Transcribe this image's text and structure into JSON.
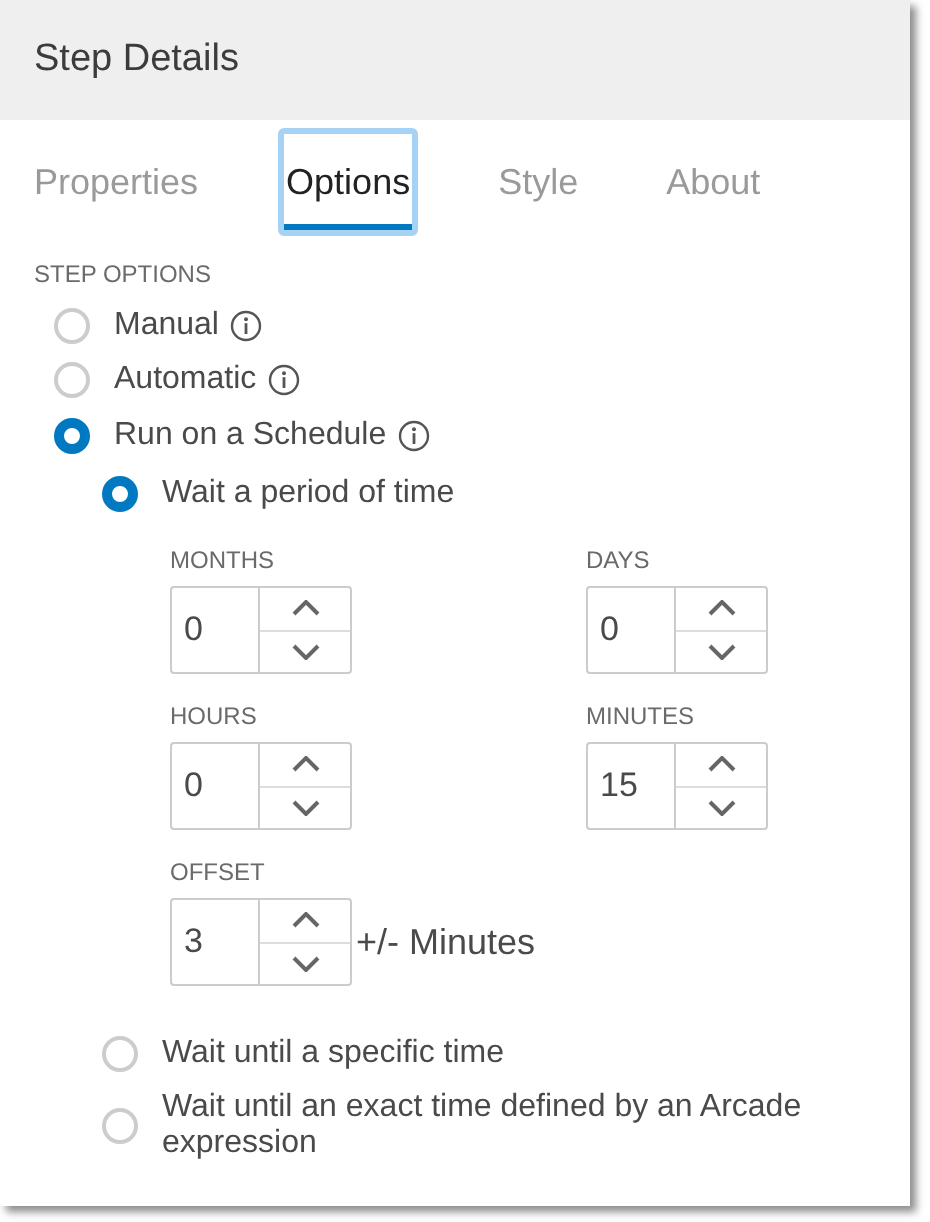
{
  "panel": {
    "title": "Step Details"
  },
  "tabs": [
    {
      "label": "Properties",
      "selected": false
    },
    {
      "label": "Options",
      "selected": true
    },
    {
      "label": "Style",
      "selected": false
    },
    {
      "label": "About",
      "selected": false
    }
  ],
  "section_label": "STEP OPTIONS",
  "modes": [
    {
      "label": "Manual",
      "selected": false,
      "info": true
    },
    {
      "label": "Automatic",
      "selected": false,
      "info": true
    },
    {
      "label": "Run on a Schedule",
      "selected": true,
      "info": true
    }
  ],
  "schedule_options": [
    {
      "label": "Wait a period of time",
      "selected": true
    },
    {
      "label": "Wait until a specific time",
      "selected": false
    },
    {
      "label": "Wait until an exact time defined by an Arcade expression",
      "selected": false
    }
  ],
  "period_fields": [
    {
      "label": "MONTHS",
      "value": "0"
    },
    {
      "label": "DAYS",
      "value": "0"
    },
    {
      "label": "HOURS",
      "value": "0"
    },
    {
      "label": "MINUTES",
      "value": "15"
    }
  ],
  "offset": {
    "label": "OFFSET",
    "value": "3",
    "unit": "+/- Minutes"
  }
}
